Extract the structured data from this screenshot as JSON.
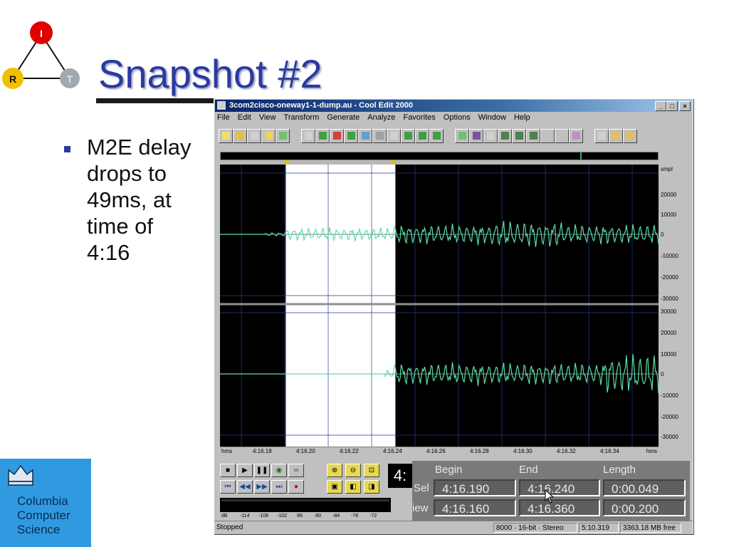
{
  "slide": {
    "title": "Snapshot #2",
    "bullet": "M2E delay\ndrops to\n49ms, at\ntime of\n4:16",
    "logo_nodes": [
      "I",
      "R",
      "T"
    ],
    "footer_logo_text": "Columbia\nComputer\nScience",
    "colors": {
      "title": "#2b3a9e",
      "node_i": "#e00000",
      "node_r": "#f0c000",
      "node_t": "#a0a8b0",
      "footer_box": "#2f9ae0"
    }
  },
  "window": {
    "title": "3com2cisco-oneway1-1-dump.au - Cool Edit 2000",
    "controls": [
      "_",
      "□",
      "×"
    ],
    "menus": [
      "File",
      "Edit",
      "View",
      "Transform",
      "Generate",
      "Analyze",
      "Favorites",
      "Options",
      "Window",
      "Help"
    ],
    "toolbar_icons": [
      "new-file-icon",
      "open-file-icon",
      "save-icon",
      "save-as-icon",
      "save-selection-icon",
      "undo-icon",
      "repeat-icon",
      "mix-icon",
      "copy-icon",
      "copy-new-icon",
      "cut-icon",
      "paste-icon",
      "paste-new-icon",
      "mix-paste-icon",
      "trim-icon",
      "zoom-icon",
      "cue-list-icon",
      "metronome-icon",
      "frequency-icon",
      "spectral-icon",
      "split-icon",
      "process-icon",
      "favorites-icon",
      "record-icon",
      "f-icon",
      "script-icon",
      "help-icon"
    ],
    "scale_right": {
      "unit": "smpl",
      "channel1": [
        "20000",
        "10000",
        "0",
        "-10000",
        "-20000",
        "-30000"
      ],
      "channel2": [
        "30000",
        "20000",
        "10000",
        "0",
        "-10000",
        "-20000",
        "-30000"
      ]
    },
    "time_axis": {
      "unit": "hms",
      "ticks": [
        "4:16.18",
        "4:16.20",
        "4:16.22",
        "4:16.24",
        "4:16.26",
        "4:16.28",
        "4:16.30",
        "4:16.32",
        "4:16.34"
      ]
    },
    "selection": {
      "begin_fraction": 0.15,
      "end_fraction": 0.4
    },
    "transport": {
      "row1": [
        "stop-button",
        "play-button",
        "pause-button",
        "play-to-end-button",
        "loop-button"
      ],
      "row2": [
        "go-to-start-button",
        "rewind-button",
        "fast-forward-button",
        "go-to-end-button",
        "record-button"
      ],
      "zoom": [
        "zoom-in-icon",
        "zoom-out-icon",
        "zoom-full-icon",
        "zoom-selection-icon",
        "zoom-left-icon",
        "zoom-right-icon"
      ]
    },
    "level_scale": [
      "dB",
      "-114",
      "-108",
      "-102",
      "-96",
      "-90",
      "-84",
      "-78",
      "-72"
    ],
    "time_display": "4:",
    "info": {
      "headers": {
        "begin": "Begin",
        "end": "End",
        "length": "Length"
      },
      "sel_label": "Sel",
      "view_label": "iew",
      "sel": {
        "begin": "4:16.190",
        "end": "4:16.240",
        "length": "0:00.049"
      },
      "view": {
        "begin": "4:16.160",
        "end": "4:16.360",
        "length": "0:00.200"
      }
    },
    "status": {
      "state": "Stopped",
      "format": "8000 · 16-bit · Stereo",
      "duration": "5:10.319",
      "free": "3363.18 MB free"
    }
  }
}
